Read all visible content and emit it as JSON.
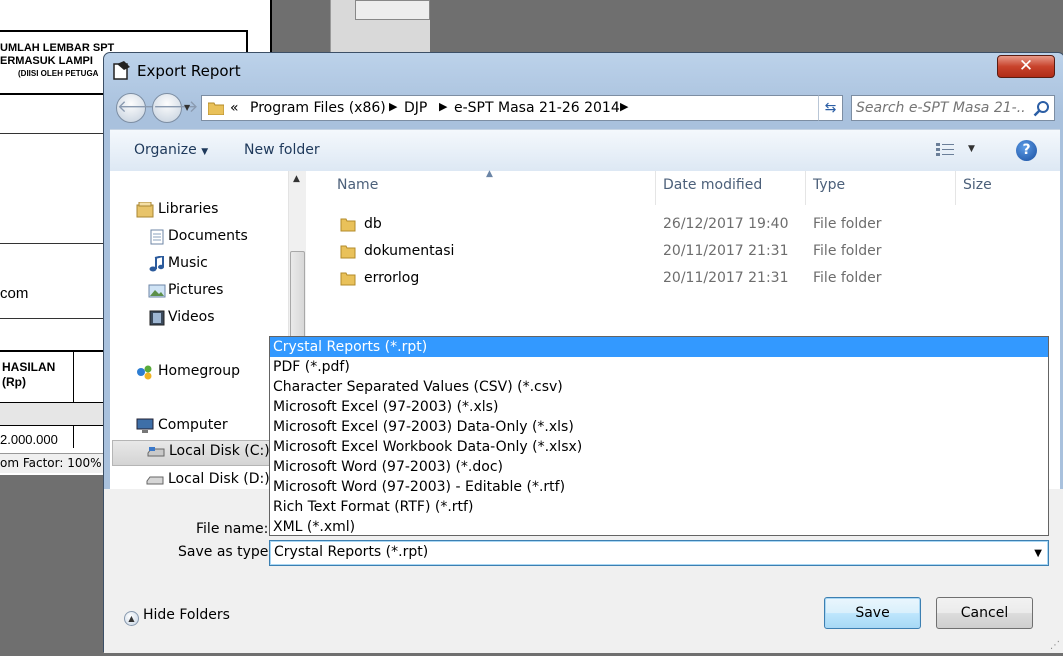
{
  "background_app": {
    "header_line1": "UMLAH LEMBAR SPT",
    "header_line2": "ERMASUK LAMPI",
    "header_line3": "(DIISI OLEH PETUGA",
    "email_fragment": "com",
    "column_line1": "HASILAN",
    "column_line2": "(Rp)",
    "amount_fragment": "2.000.000",
    "zoom_status": "om Factor: 100%"
  },
  "dialog": {
    "title": "Export Report",
    "close_label": "✕",
    "address": {
      "overflow": "«",
      "crumbs": [
        "Program Files (x86)",
        "DJP",
        "e-SPT Masa 21-26 2014"
      ]
    },
    "search": {
      "placeholder": "Search e-SPT Masa 21-..."
    },
    "toolbar": {
      "organize_label": "Organize",
      "new_folder_label": "New folder",
      "help_label": "?"
    },
    "nav": {
      "libraries": "Libraries",
      "documents": "Documents",
      "music": "Music",
      "pictures": "Pictures",
      "videos": "Videos",
      "homegroup": "Homegroup",
      "computer": "Computer",
      "local_disk_c": "Local Disk (C:)",
      "local_disk_d": "Local Disk (D:)"
    },
    "columns": {
      "name": "Name",
      "date_modified": "Date modified",
      "type": "Type",
      "size": "Size"
    },
    "files": [
      {
        "name": "db",
        "date": "26/12/2017 19:40",
        "type": "File folder"
      },
      {
        "name": "dokumentasi",
        "date": "20/11/2017 21:31",
        "type": "File folder"
      },
      {
        "name": "errorlog",
        "date": "20/11/2017 21:31",
        "type": "File folder"
      }
    ],
    "file_name_label": "File name:",
    "save_as_type_label": "Save as type:",
    "save_as_type_value": "Crystal Reports (*.rpt)",
    "type_options": [
      "Crystal Reports (*.rpt)",
      "PDF (*.pdf)",
      "Character Separated Values (CSV) (*.csv)",
      "Microsoft Excel (97-2003) (*.xls)",
      "Microsoft Excel (97-2003) Data-Only (*.xls)",
      "Microsoft Excel Workbook Data-Only (*.xlsx)",
      "Microsoft Word (97-2003) (*.doc)",
      "Microsoft Word (97-2003) - Editable (*.rtf)",
      "Rich Text Format (RTF) (*.rtf)",
      "XML (*.xml)"
    ],
    "hide_folders_label": "Hide Folders",
    "save_label": "Save",
    "cancel_label": "Cancel"
  }
}
